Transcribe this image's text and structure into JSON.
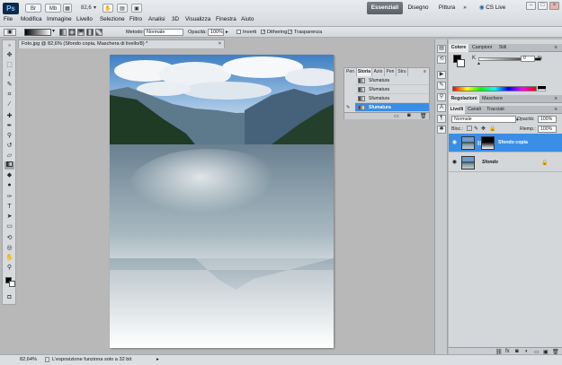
{
  "app": {
    "logo": "Ps",
    "zoom": "82,6",
    "menu": [
      "File",
      "Modifica",
      "Immagine",
      "Livello",
      "Selezione",
      "Filtro",
      "Analisi",
      "3D",
      "Visualizza",
      "Finestra",
      "Aiuto"
    ],
    "workspaces": [
      "Essenziali",
      "Disegno",
      "Pittura"
    ],
    "active_workspace": "Essenziali",
    "more": "»",
    "cs_live": "CS Live",
    "win_controls": [
      "–",
      "□",
      "×"
    ]
  },
  "options": {
    "metodo_label": "Metodo:",
    "metodo_value": "Normale",
    "opacita_label": "Opacità:",
    "opacita_value": "100%",
    "inverti": "Inverti",
    "dithering": "Dithering",
    "trasparenza": "Trasparenza"
  },
  "document": {
    "tab_title": "Foto.jpg @ 82,6% (Sfondo copia, Maschera di livello/8) *"
  },
  "storia": {
    "tabs": [
      "Pen",
      "Storia",
      "Azio",
      "Pen",
      "Stru"
    ],
    "active_tab": "Storia",
    "items": [
      "Sfumatura",
      "Sfumatura",
      "Sfumatura",
      "Sfumatura"
    ],
    "selected_index": 3
  },
  "color_panel": {
    "tabs": [
      "Colore",
      "Campioni",
      "Stili"
    ],
    "active_tab": "Colore",
    "k_label": "K",
    "k_value": "0",
    "k_unit": "%"
  },
  "adjust_panel": {
    "tabs": [
      "Regolazioni",
      "Maschere"
    ]
  },
  "layers_panel": {
    "tabs": [
      "Livelli",
      "Canali",
      "Tracciati"
    ],
    "active_tab": "Livelli",
    "blend_mode": "Normale",
    "opacity_label": "Opacità:",
    "opacity_value": "100%",
    "lock_label": "Bloc.:",
    "fill_label": "Riemp.:",
    "fill_value": "100%",
    "layers": [
      {
        "name": "Sfondo copia",
        "selected": true
      },
      {
        "name": "Sfondo",
        "selected": false
      }
    ]
  },
  "status": {
    "zoom": "82,64%",
    "message": "L'esposizione funziona solo a 32 bit"
  },
  "colors": {
    "accent": "#3a8ee6",
    "workspace_bg": "#b8b8b8"
  }
}
